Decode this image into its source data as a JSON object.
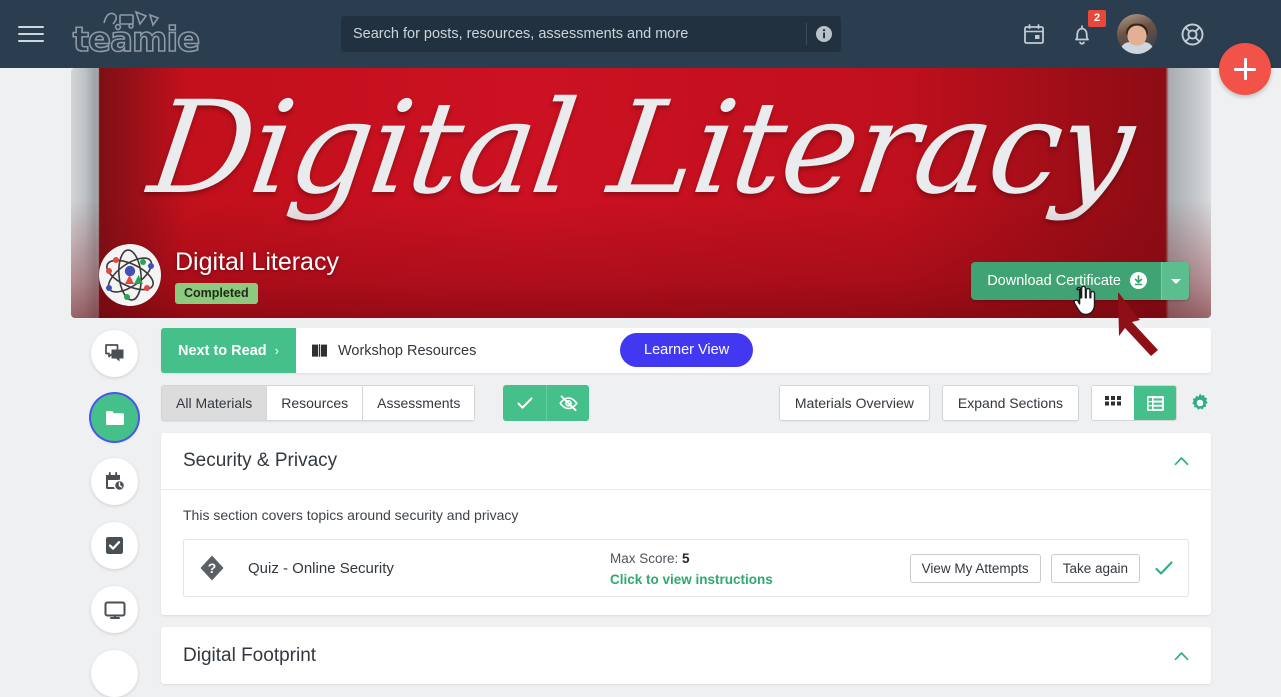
{
  "topnav": {
    "menu_icon": "hamburger-icon",
    "brand": "teamie",
    "search": {
      "placeholder": "Search for posts, resources, assessments and more",
      "value": "",
      "info_icon": "info-icon"
    },
    "calendar_icon": "calendar-icon",
    "notifications": {
      "icon": "bell-icon",
      "badge": "2"
    },
    "avatar": "user-avatar",
    "help_icon": "lifebuoy-icon",
    "fab": {
      "icon": "plus-icon",
      "color": "#f25247"
    }
  },
  "banner": {
    "script_text": "Digital Literacy",
    "course_logo": "atom-icon",
    "course_title": "Digital Literacy",
    "status": "Completed",
    "status_color": "#8dc97e",
    "download_button": {
      "label": "Download Certificate",
      "icon": "download-circle-icon",
      "caret_icon": "chevron-down-icon",
      "color": "#3fa373"
    },
    "bg_color": "#cc1122"
  },
  "rail": {
    "items": [
      {
        "name": "sidebar-item-chat",
        "icon": "chat-bubbles-icon",
        "active": false
      },
      {
        "name": "sidebar-item-materials",
        "icon": "folder-icon",
        "active": true
      },
      {
        "name": "sidebar-item-schedule",
        "icon": "calendar-clock-icon",
        "active": false
      },
      {
        "name": "sidebar-item-tasks",
        "icon": "checkbox-icon",
        "active": false
      },
      {
        "name": "sidebar-item-classroom",
        "icon": "monitor-icon",
        "active": false
      }
    ]
  },
  "topbar": {
    "next_to_read": "Next to Read",
    "next_chevron": "›",
    "workshop_icon": "book-icon",
    "workshop_label": "Workshop Resources",
    "learner_view": "Learner View",
    "learner_view_color": "#4338f2"
  },
  "toolbar": {
    "filters": [
      {
        "label": "All Materials",
        "active": true
      },
      {
        "label": "Resources",
        "active": false
      },
      {
        "label": "Assessments",
        "active": false
      }
    ],
    "green_actions": [
      {
        "name": "mark-complete-toggle",
        "icon": "check-icon"
      },
      {
        "name": "hide-completed-toggle",
        "icon": "eye-slash-icon"
      }
    ],
    "materials_overview": "Materials Overview",
    "expand_sections": "Expand Sections",
    "views": [
      {
        "name": "grid-view-button",
        "icon": "grid-icon",
        "active": false
      },
      {
        "name": "list-view-button",
        "icon": "list-icon",
        "active": true
      }
    ],
    "settings_icon": "gear-icon",
    "accent_color": "#45c08a"
  },
  "sections": [
    {
      "title": "Security & Privacy",
      "collapse_icon": "chevron-up-icon",
      "description": "This section covers topics around security and privacy",
      "materials": [
        {
          "icon": "quiz-diamond-icon",
          "name": "Quiz - Online Security",
          "max_score_label": "Max Score:",
          "max_score_value": "5",
          "instructions_link": "Click to view instructions",
          "actions": [
            "View My Attempts",
            "Take again"
          ],
          "completed_icon": "check-icon"
        }
      ]
    },
    {
      "title": "Digital Footprint",
      "collapse_icon": "chevron-up-icon",
      "description": "",
      "materials": []
    }
  ]
}
